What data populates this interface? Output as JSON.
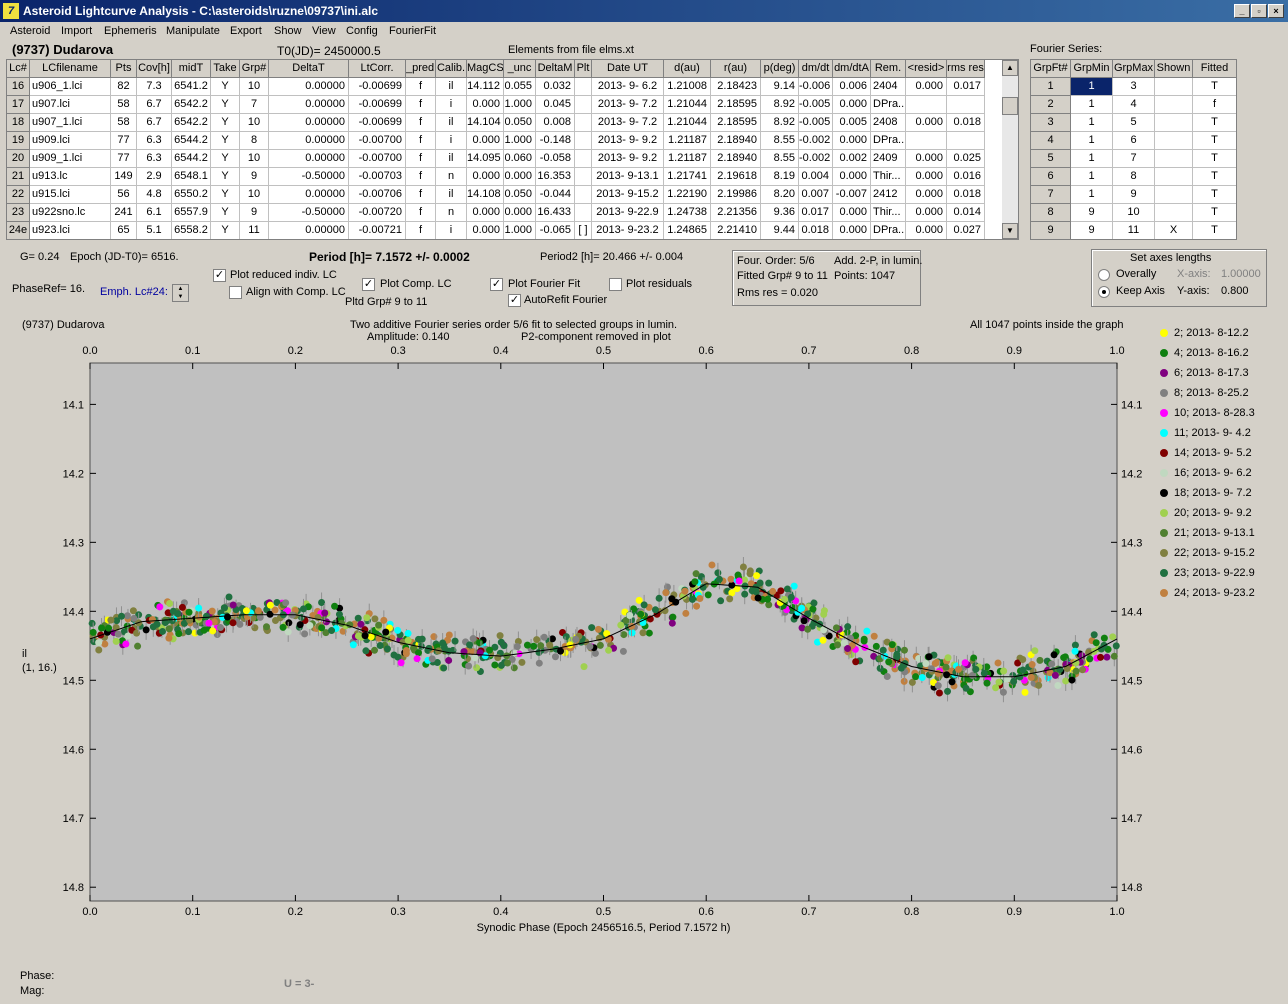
{
  "window": {
    "title": "Asteroid Lightcurve Analysis - C:\\asteroids\\ruzne\\09737\\ini.alc",
    "app_icon": "7",
    "min": "_",
    "max": "▫",
    "close": "×"
  },
  "menu": [
    "Asteroid",
    "Import",
    "Ephemeris",
    "Manipulate",
    "Export",
    "Show",
    "View",
    "Config",
    "FourierFit"
  ],
  "header": {
    "asteroid": "(9737) Dudarova",
    "t0": "T0(JD)= 2450000.5",
    "elements": "Elements from file elms.xt",
    "fourier_series": "Fourier Series:"
  },
  "lc_table": {
    "columns": [
      "Lc#",
      "LCfilename",
      "Pts",
      "Cov[h]",
      "midT",
      "Take",
      "Grp#",
      "DeltaT",
      "LtCorr.",
      "_pred.",
      "Calib.",
      "MagCS",
      "_unc",
      "DeltaM",
      "Plt",
      "Date UT",
      "d(au)",
      "r(au)",
      "p(deg)",
      "dm/dt",
      "dm/dtA",
      "Rem.",
      "<resid>",
      "rms res"
    ],
    "rows": [
      [
        "16",
        "u906_1.lci",
        "82",
        "7.3",
        "6541.2",
        "Y",
        "10",
        "0.00000",
        "-0.00699",
        "f",
        "il",
        "14.112",
        "0.055",
        "0.032",
        "",
        "2013- 9- 6.2",
        "1.21008",
        "2.18423",
        "9.14",
        "-0.006",
        "0.006",
        "2404",
        "0.000",
        "0.017"
      ],
      [
        "17",
        "u907.lci",
        "58",
        "6.7",
        "6542.2",
        "Y",
        "7",
        "0.00000",
        "-0.00699",
        "f",
        "i",
        "0.000",
        "1.000",
        "0.045",
        "",
        "2013- 9- 7.2",
        "1.21044",
        "2.18595",
        "8.92",
        "-0.005",
        "0.000",
        "DPra...",
        "",
        ""
      ],
      [
        "18",
        "u907_1.lci",
        "58",
        "6.7",
        "6542.2",
        "Y",
        "10",
        "0.00000",
        "-0.00699",
        "f",
        "il",
        "14.104",
        "0.050",
        "0.008",
        "",
        "2013- 9- 7.2",
        "1.21044",
        "2.18595",
        "8.92",
        "-0.005",
        "0.005",
        "2408",
        "0.000",
        "0.018"
      ],
      [
        "19",
        "u909.lci",
        "77",
        "6.3",
        "6544.2",
        "Y",
        "8",
        "0.00000",
        "-0.00700",
        "f",
        "i",
        "0.000",
        "1.000",
        "-0.148",
        "",
        "2013- 9- 9.2",
        "1.21187",
        "2.18940",
        "8.55",
        "-0.002",
        "0.000",
        "DPra...",
        "",
        ""
      ],
      [
        "20",
        "u909_1.lci",
        "77",
        "6.3",
        "6544.2",
        "Y",
        "10",
        "0.00000",
        "-0.00700",
        "f",
        "il",
        "14.095",
        "0.060",
        "-0.058",
        "",
        "2013- 9- 9.2",
        "1.21187",
        "2.18940",
        "8.55",
        "-0.002",
        "0.002",
        "2409",
        "0.000",
        "0.025"
      ],
      [
        "21",
        "u913.lc",
        "149",
        "2.9",
        "6548.1",
        "Y",
        "9",
        "-0.50000",
        "-0.00703",
        "f",
        "n",
        "0.000",
        "0.000",
        "16.353",
        "",
        "2013- 9-13.1",
        "1.21741",
        "2.19618",
        "8.19",
        "0.004",
        "0.000",
        "Thir...",
        "0.000",
        "0.016"
      ],
      [
        "22",
        "u915.lci",
        "56",
        "4.8",
        "6550.2",
        "Y",
        "10",
        "0.00000",
        "-0.00706",
        "f",
        "il",
        "14.108",
        "0.050",
        "-0.044",
        "",
        "2013- 9-15.2",
        "1.22190",
        "2.19986",
        "8.20",
        "0.007",
        "-0.007",
        "2412",
        "0.000",
        "0.018"
      ],
      [
        "23",
        "u922sno.lc",
        "241",
        "6.1",
        "6557.9",
        "Y",
        "9",
        "-0.50000",
        "-0.00720",
        "f",
        "n",
        "0.000",
        "0.000",
        "16.433",
        "",
        "2013- 9-22.9",
        "1.24738",
        "2.21356",
        "9.36",
        "0.017",
        "0.000",
        "Thir...",
        "0.000",
        "0.014"
      ],
      [
        "24e",
        "u923.lci",
        "65",
        "5.1",
        "6558.2",
        "Y",
        "11",
        "0.00000",
        "-0.00721",
        "f",
        "i",
        "0.000",
        "1.000",
        "-0.065",
        "[ ]",
        "2013- 9-23.2",
        "1.24865",
        "2.21410",
        "9.44",
        "0.018",
        "0.000",
        "DPra...",
        "0.000",
        "0.027"
      ]
    ]
  },
  "fourier_table": {
    "columns": [
      "GrpFt#",
      "GrpMin",
      "GrpMax",
      "Shown",
      "Fitted"
    ],
    "rows": [
      [
        "1",
        "1",
        "3",
        "",
        "T"
      ],
      [
        "2",
        "1",
        "4",
        "",
        "f"
      ],
      [
        "3",
        "1",
        "5",
        "",
        "T"
      ],
      [
        "4",
        "1",
        "6",
        "",
        "T"
      ],
      [
        "5",
        "1",
        "7",
        "",
        "T"
      ],
      [
        "6",
        "1",
        "8",
        "",
        "T"
      ],
      [
        "7",
        "1",
        "9",
        "",
        "T"
      ],
      [
        "8",
        "9",
        "10",
        "",
        "T"
      ],
      [
        "9",
        "9",
        "11",
        "X",
        "T"
      ]
    ]
  },
  "controls": {
    "g": "G= 0.24",
    "epoch": "Epoch (JD-T0)= 6516.",
    "period": "Period [h]= 7.1572 +/- 0.0002",
    "period2": "Period2 [h]= 20.466 +/- 0.004",
    "phaseref": "PhaseRef= 16.",
    "emph": "Emph. Lc#24:",
    "cb_reduced": "Plot reduced indiv. LC",
    "cb_align": "Align with Comp. LC",
    "cb_comp": "Plot Comp. LC",
    "pltd_grp": "Pltd Grp#  9  to   11",
    "cb_fourier": "Plot Fourier Fit",
    "cb_autorefit": "AutoRefit Fourier",
    "cb_residuals": "Plot residuals",
    "four_order": "Four. Order:  5/6",
    "add2p": "Add. 2-P, in lumin.",
    "fitted_grp": "Fitted Grp# 9 to 11",
    "points": "Points: 1047",
    "rms": "Rms res     = 0.020",
    "axes_title": "Set axes lengths",
    "overally": "Overally",
    "keep_axis": "Keep Axis",
    "xaxis_label": "X-axis:",
    "xaxis_val": "1.00000",
    "yaxis_label": "Y-axis:",
    "yaxis_val": "0.800"
  },
  "plot": {
    "name": "(9737) Dudarova",
    "subtitle1": "Two additive Fourier series order 5/6 fit to selected groups in lumin.",
    "subtitle2": "Amplitude: 0.140",
    "subtitle3": "P2-component removed in plot",
    "inside": "All 1047 points inside the graph",
    "ylabel1": "il",
    "ylabel2": "(1, 16.)"
  },
  "status": {
    "phase": "Phase:",
    "mag": "Mag:",
    "u": "U = 3-"
  },
  "chart_data": {
    "type": "scatter",
    "xlabel": "Synodic Phase (Epoch 2456516.5, Period 7.1572 h)",
    "xlim": [
      0,
      1.0
    ],
    "ylim": [
      14.82,
      14.04
    ],
    "y_reversed": true,
    "xticks": [
      "0.0",
      "0.1",
      "0.2",
      "0.3",
      "0.4",
      "0.5",
      "0.6",
      "0.7",
      "0.8",
      "0.9",
      "1.0"
    ],
    "yticks": [
      "14.1",
      "14.2",
      "14.3",
      "14.4",
      "14.5",
      "14.6",
      "14.7",
      "14.8"
    ],
    "fit_curve": {
      "x": [
        0,
        0.05,
        0.1,
        0.15,
        0.2,
        0.25,
        0.3,
        0.35,
        0.4,
        0.45,
        0.5,
        0.55,
        0.6,
        0.65,
        0.7,
        0.75,
        0.8,
        0.85,
        0.9,
        0.95,
        1.0
      ],
      "y": [
        14.44,
        14.415,
        14.41,
        14.405,
        14.405,
        14.42,
        14.445,
        14.46,
        14.465,
        14.455,
        14.44,
        14.405,
        14.36,
        14.365,
        14.41,
        14.45,
        14.48,
        14.495,
        14.495,
        14.48,
        14.44
      ]
    },
    "series": [
      {
        "name": "2; 2013- 8-12.2",
        "color": "#ffff00"
      },
      {
        "name": "4; 2013- 8-16.2",
        "color": "#108010"
      },
      {
        "name": "6; 2013- 8-17.3",
        "color": "#800080"
      },
      {
        "name": "8; 2013- 8-25.2",
        "color": "#808080"
      },
      {
        "name": "10; 2013- 8-28.3",
        "color": "#ff00ff"
      },
      {
        "name": "11; 2013- 9- 4.2",
        "color": "#00ffff"
      },
      {
        "name": "14; 2013- 9- 5.2",
        "color": "#800000"
      },
      {
        "name": "16; 2013- 9- 6.2",
        "color": "#c0d8c0"
      },
      {
        "name": "18; 2013- 9- 7.2",
        "color": "#000000"
      },
      {
        "name": "20; 2013- 9- 9.2",
        "color": "#a0d050"
      },
      {
        "name": "21; 2013- 9-13.1",
        "color": "#508030"
      },
      {
        "name": "22; 2013- 9-15.2",
        "color": "#808040"
      },
      {
        "name": "23; 2013- 9-22.9",
        "color": "#207040"
      },
      {
        "name": "24; 2013- 9-23.2",
        "color": "#c08040"
      }
    ]
  }
}
